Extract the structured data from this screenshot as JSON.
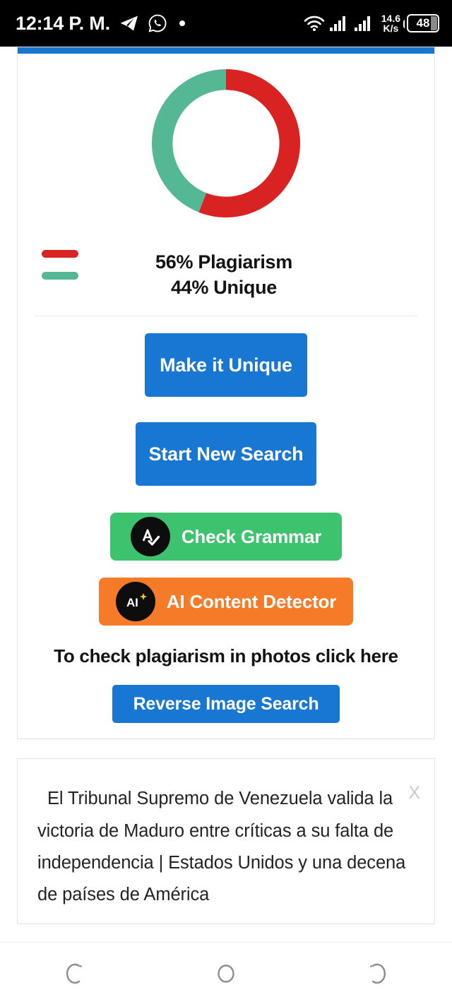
{
  "status_bar": {
    "clock": "12:14 P. M.",
    "icons": [
      "telegram-icon",
      "whatsapp-icon",
      "dot-indicator"
    ],
    "network_speed_value": "14.6",
    "network_speed_unit": "K/s",
    "battery_level": "48",
    "right_icons": [
      "wifi-icon",
      "signal-sim1-icon",
      "signal-sim2-icon"
    ]
  },
  "result_card": {
    "accent_color": "#1877D2",
    "legend": {
      "plagiarism_label": "56% Plagiarism",
      "unique_label": "44% Unique",
      "plagiarism_color": "#D92323",
      "unique_color": "#55B894"
    },
    "buttons": {
      "make_unique": "Make it Unique",
      "start_new_search": "Start New Search",
      "check_grammar": "Check Grammar",
      "ai_content_detector": "AI Content Detector",
      "reverse_image_search": "Reverse Image Search"
    },
    "icons": {
      "grammar_icon_text": "A",
      "ai_icon_text": "AI"
    },
    "helper_text": "To check plagiarism in photos click here",
    "colors": {
      "primary_blue": "#1877D2",
      "grammar_green": "#3DC26E",
      "ai_orange": "#F57B28"
    }
  },
  "source_card": {
    "text": "El Tribunal Supremo de Venezuela valida la victoria de Maduro entre críticas a su falta de independencia | Estados Unidos y una decena de países de América",
    "close_label": "X"
  },
  "nav_bar": {
    "items": [
      {
        "name": "back-gesture-icon"
      },
      {
        "name": "home-circle-icon"
      },
      {
        "name": "recents-gesture-icon"
      }
    ]
  },
  "chart_data": {
    "type": "pie",
    "title": "",
    "labels": [
      "Plagiarism",
      "Unique"
    ],
    "values": [
      56,
      44
    ],
    "colors": [
      "#D92323",
      "#55B894"
    ],
    "units": "percent",
    "donut": true,
    "inner_radius_ratio": 0.72,
    "start_angle_deg": 0,
    "direction": "clockwise",
    "legend_position": "below",
    "legend_entries": [
      {
        "label": "56% Plagiarism",
        "color": "#D92323",
        "value": 56
      },
      {
        "label": "44% Unique",
        "color": "#55B894",
        "value": 44
      }
    ]
  }
}
